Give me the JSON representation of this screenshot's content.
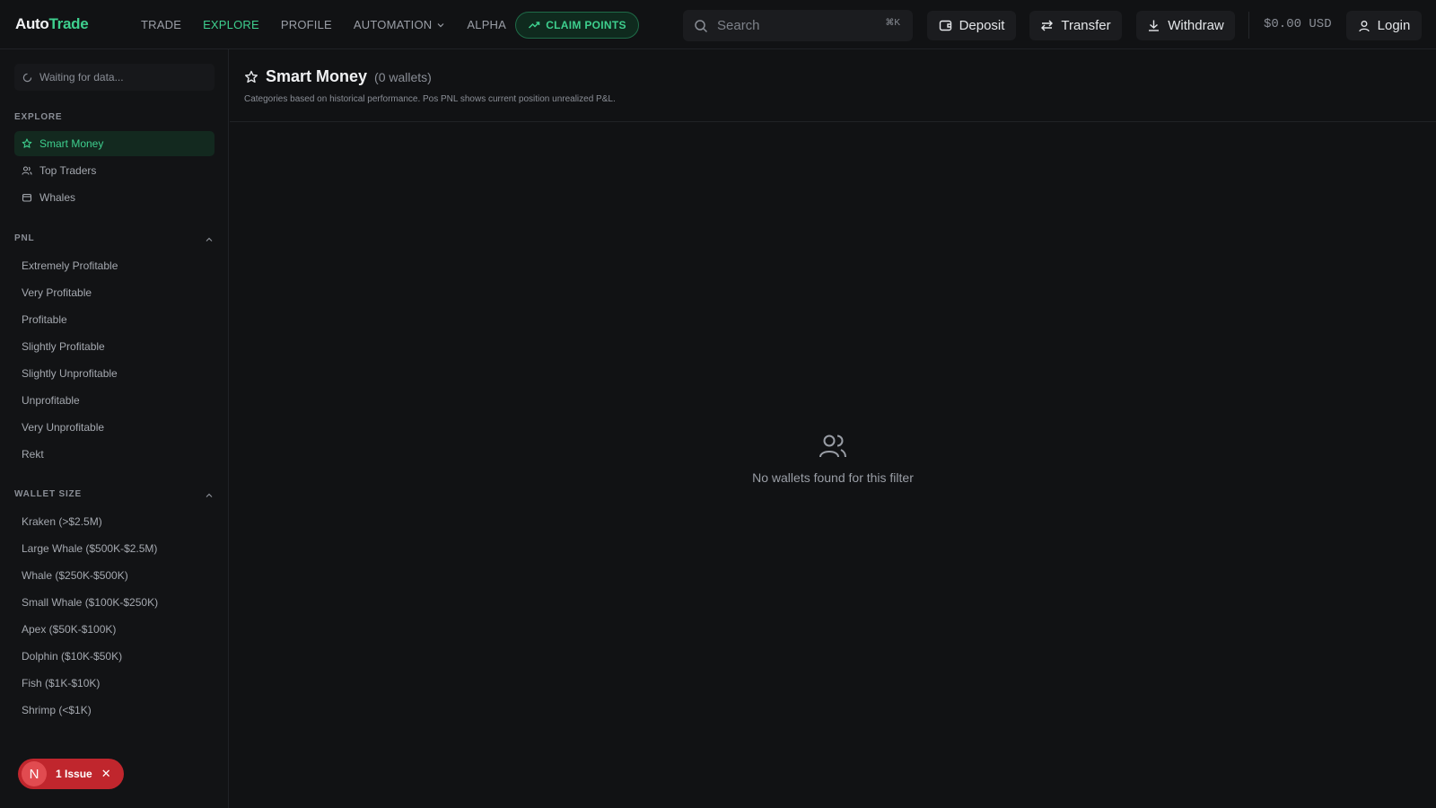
{
  "app": {
    "logo_part1": "Auto",
    "logo_part2": "Trade"
  },
  "nav": {
    "items": [
      {
        "label": "TRADE",
        "active": false
      },
      {
        "label": "EXPLORE",
        "active": true
      },
      {
        "label": "PROFILE",
        "active": false
      },
      {
        "label": "AUTOMATION",
        "active": false,
        "dropdown": true
      },
      {
        "label": "ALPHA",
        "active": false
      }
    ],
    "claim_label": "CLAIM POINTS"
  },
  "search": {
    "placeholder": "Search",
    "shortcut": "⌘K"
  },
  "actions": {
    "deposit": "Deposit",
    "transfer": "Transfer",
    "withdraw": "Withdraw",
    "login": "Login"
  },
  "balance": "$0.00 USD",
  "sidebar": {
    "status": "Waiting for data...",
    "explore_title": "EXPLORE",
    "explore_items": [
      {
        "label": "Smart Money",
        "icon": "star-icon",
        "active": true
      },
      {
        "label": "Top Traders",
        "icon": "users-icon",
        "active": false
      },
      {
        "label": "Whales",
        "icon": "wallet-icon",
        "active": false
      }
    ],
    "pnl_title": "PNL",
    "pnl_items": [
      "Extremely Profitable",
      "Very Profitable",
      "Profitable",
      "Slightly Profitable",
      "Slightly Unprofitable",
      "Unprofitable",
      "Very Unprofitable",
      "Rekt"
    ],
    "size_title": "WALLET SIZE",
    "size_items": [
      "Kraken (>$2.5M)",
      "Large Whale ($500K-$2.5M)",
      "Whale ($250K-$500K)",
      "Small Whale ($100K-$250K)",
      "Apex ($50K-$100K)",
      "Dolphin ($10K-$50K)",
      "Fish ($1K-$10K)",
      "Shrimp (<$1K)"
    ]
  },
  "main": {
    "title": "Smart Money",
    "count": "(0 wallets)",
    "subtitle": "Categories based on historical performance. Pos PNL shows current position unrealized P&L.",
    "empty_message": "No wallets found for this filter"
  },
  "issue": {
    "avatar": "N",
    "label": "1 Issue"
  },
  "colors": {
    "accent": "#3ecf8e",
    "background": "#111214",
    "danger": "#c0262d"
  }
}
